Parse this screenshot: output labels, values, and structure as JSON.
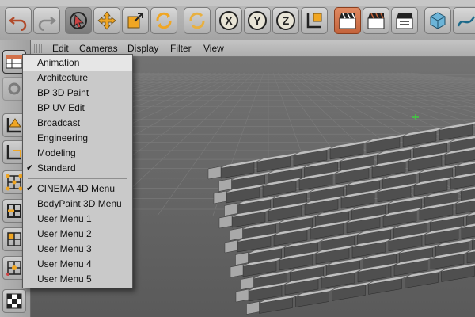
{
  "toolbar": {
    "axis_buttons": [
      "X",
      "Y",
      "Z"
    ]
  },
  "viewport_menu": {
    "items": [
      "Edit",
      "Cameras",
      "Display",
      "Filter",
      "View"
    ]
  },
  "layout_menu": {
    "items": [
      {
        "label": "Animation",
        "checked": false,
        "highlighted": true
      },
      {
        "label": "Architecture",
        "checked": false
      },
      {
        "label": "BP 3D Paint",
        "checked": false
      },
      {
        "label": "BP UV Edit",
        "checked": false
      },
      {
        "label": "Broadcast",
        "checked": false
      },
      {
        "label": "Engineering",
        "checked": false
      },
      {
        "label": "Modeling",
        "checked": false
      },
      {
        "label": "Standard",
        "checked": true
      },
      {
        "label": "CINEMA 4D Menu",
        "checked": true
      },
      {
        "label": "BodyPaint 3D Menu",
        "checked": false
      },
      {
        "label": "User Menu 1",
        "checked": false
      },
      {
        "label": "User Menu 2",
        "checked": false
      },
      {
        "label": "User Menu 3",
        "checked": false
      },
      {
        "label": "User Menu 4",
        "checked": false
      },
      {
        "label": "User Menu 5",
        "checked": false
      }
    ],
    "check_glyph": "✔"
  },
  "colors": {
    "accent_orange": "#d2714a",
    "menu_background": "#c9c9c9",
    "viewport_background": "#6e6e6e",
    "brick": "#4f4f4f"
  }
}
